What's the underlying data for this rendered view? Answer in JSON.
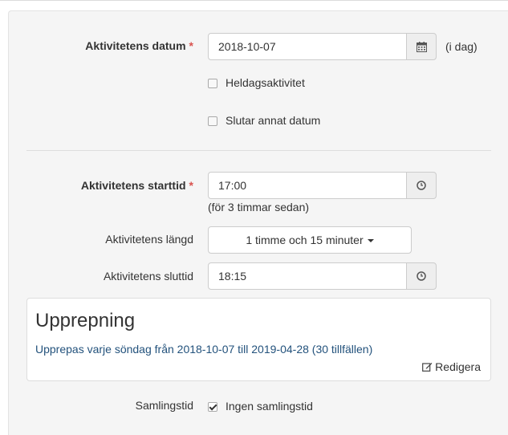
{
  "date": {
    "label": "Aktivitetens datum",
    "required": "*",
    "value": "2018-10-07",
    "icon": "calendar-icon",
    "relative": "(i dag)"
  },
  "checkboxes": {
    "all_day": {
      "label": "Heldagsaktivitet",
      "checked": false
    },
    "end_other_date": {
      "label": "Slutar annat datum",
      "checked": false
    }
  },
  "start": {
    "label": "Aktivitetens starttid",
    "required": "*",
    "value": "17:00",
    "icon": "clock-icon",
    "hint": "(för 3 timmar sedan)"
  },
  "duration": {
    "label": "Aktivitetens längd",
    "value": "1 timme och 15 minuter"
  },
  "end": {
    "label": "Aktivitetens sluttid",
    "value": "18:15",
    "icon": "clock-icon"
  },
  "repeat": {
    "title": "Upprepning",
    "description": "Upprepas varje söndag från 2018-10-07 till 2019-04-28 (30 tillfällen)",
    "edit_label": "Redigera",
    "edit_icon": "edit-icon"
  },
  "gathering": {
    "label": "Samlingstid",
    "option_label": "Ingen samlingstid",
    "checked": true
  },
  "colors": {
    "required": "#d9534f",
    "link": "#23527c",
    "panel_bg": "#f5f5f5"
  }
}
